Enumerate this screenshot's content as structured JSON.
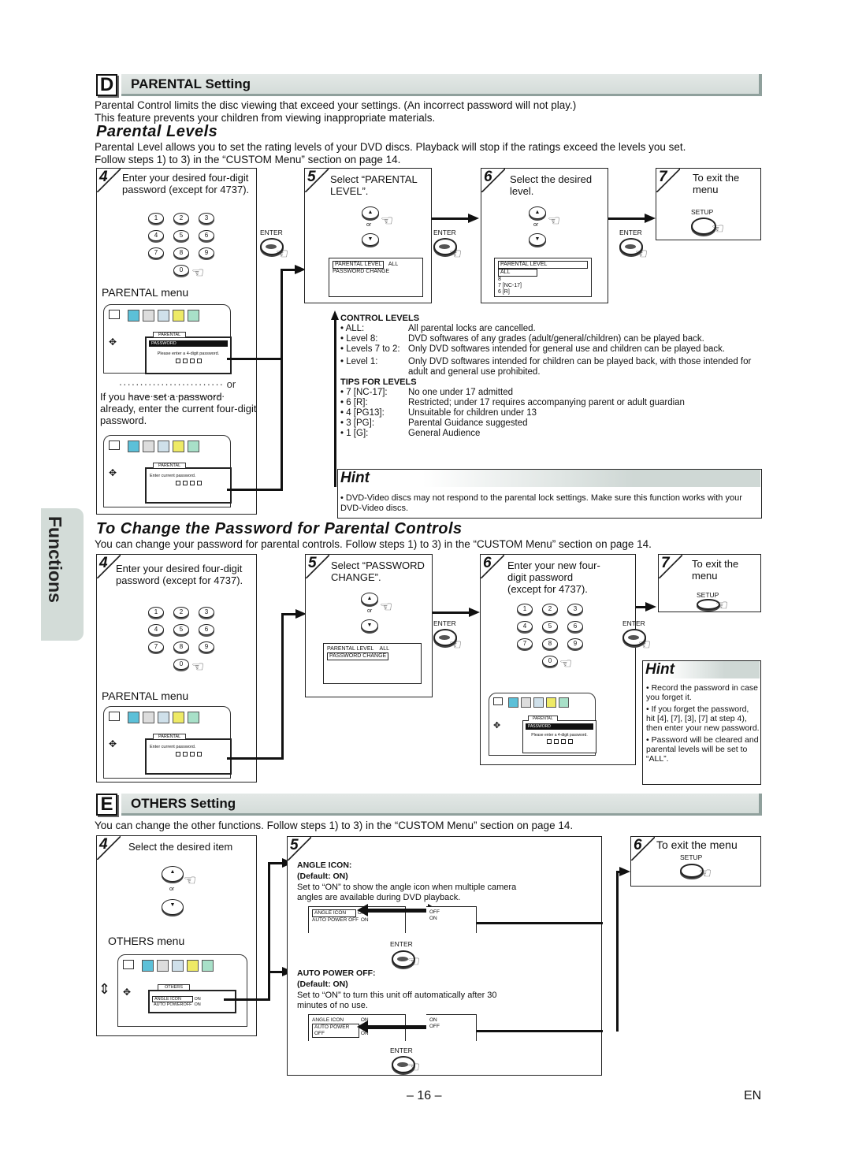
{
  "side_tab": {
    "label": "Functions"
  },
  "section_d": {
    "letter": "D",
    "title": "PARENTAL Setting",
    "intro": [
      "Parental Control limits the disc viewing that exceed your settings. (An incorrect password will not play.)",
      "This feature prevents your children from viewing inappropriate materials."
    ],
    "levels": {
      "heading": "Parental Levels",
      "desc": [
        "Parental Level allows you to set the rating levels of your DVD discs. Playback will stop if the ratings exceed the levels you set.",
        "Follow steps 1) to 3) in the “CUSTOM Menu” section on page 14."
      ],
      "step4": {
        "num": "4",
        "text": "Enter your desired four-digit password (except for 4737).",
        "menu_label": "PARENTAL menu",
        "or_label": "or",
        "alt_text": "If you have set a password already, enter the current four-digit password.",
        "osd_tab": "PARENTAL",
        "osd_title": "PASSWORD",
        "osd_prompt": "Please enter a 4-digit password.",
        "osd_alt_prompt": "Enter current password."
      },
      "step5": {
        "num": "5",
        "text": "Select “PARENTAL LEVEL”.",
        "or_label": "or",
        "osd_line1_item": "PARENTAL LEVEL",
        "osd_line1_value": "ALL",
        "osd_line2": "PASSWORD CHANGE"
      },
      "step6": {
        "num": "6",
        "text": "Select the desired level.",
        "or_label": "or",
        "osd_title": "PARENTAL LEVEL",
        "osd_items": [
          "ALL",
          "8",
          "7 [NC-17]",
          "6 [R]"
        ]
      },
      "step7": {
        "num": "7",
        "text": "To exit the menu",
        "button": "SETUP"
      },
      "enter_label": "ENTER",
      "control_levels": {
        "title": "CONTROL LEVELS",
        "rows": [
          {
            "k": "• ALL:",
            "v": "All parental locks are cancelled."
          },
          {
            "k": "• Level 8:",
            "v": "DVD softwares of any grades (adult/general/children) can be played back."
          },
          {
            "k": "• Levels 7 to 2:",
            "v": "Only DVD softwares intended for general use and children can be played back."
          },
          {
            "k": "• Level 1:",
            "v": "Only DVD softwares intended for children can be played back, with those intended for adult and general use prohibited."
          }
        ]
      },
      "tips": {
        "title": "TIPS FOR LEVELS",
        "rows": [
          {
            "k": "• 7 [NC-17]:",
            "v": "No one under 17 admitted"
          },
          {
            "k": "• 6 [R]:",
            "v": "Restricted; under 17 requires accompanying parent or adult guardian"
          },
          {
            "k": "• 4 [PG13]:",
            "v": "Unsuitable for children under 13"
          },
          {
            "k": "• 3 [PG]:",
            "v": "Parental Guidance suggested"
          },
          {
            "k": "• 1 [G]:",
            "v": "General Audience"
          }
        ]
      },
      "hint": {
        "title": "Hint",
        "text": "• DVD-Video discs may not respond to the parental lock settings. Make sure this function works with your DVD-Video discs."
      }
    },
    "password": {
      "heading": "To Change the Password for Parental Controls",
      "desc": "You can change your password for parental controls. Follow steps 1) to 3) in the “CUSTOM Menu” section on page 14.",
      "step4": {
        "num": "4",
        "text": "Enter your desired four-digit password (except for 4737).",
        "menu_label": "PARENTAL menu",
        "osd_tab": "PARENTAL",
        "osd_prompt": "Enter current password."
      },
      "step5": {
        "num": "5",
        "text": "Select “PASSWORD CHANGE”.",
        "or_label": "or",
        "osd_line1_item": "PARENTAL LEVEL",
        "osd_line1_value": "ALL",
        "osd_line2": "PASSWORD CHANGE"
      },
      "step6": {
        "num": "6",
        "text": "Enter your new four-digit password (except for 4737).",
        "osd_tab": "PARENTAL",
        "osd_title": "PASSWORD",
        "osd_prompt": "Please enter a 4-digit password."
      },
      "step7": {
        "num": "7",
        "text": "To exit the menu",
        "button": "SETUP"
      },
      "enter_label": "ENTER",
      "hint": {
        "title": "Hint",
        "items": [
          "Record the password in case you forget it.",
          "If you forget the password, hit [4], [7], [3], [7] at step 4), then enter your new password.",
          "Password will be cleared and parental levels will be set to “ALL”."
        ]
      }
    }
  },
  "keypad": [
    "1",
    "2",
    "3",
    "4",
    "5",
    "6",
    "7",
    "8",
    "9",
    "0"
  ],
  "section_e": {
    "letter": "E",
    "title": "OTHERS Setting",
    "desc": "You can change the other functions. Follow steps 1) to 3) in the “CUSTOM Menu” section on page 14.",
    "step4": {
      "num": "4",
      "text": "Select the desired item",
      "or_label": "or",
      "menu_label": "OTHERS menu",
      "osd_tab": "OTHERS",
      "osd_rows": [
        {
          "item": "ANGLE ICON",
          "value": "ON"
        },
        {
          "item": "AUTO POWEROFF",
          "value": "ON"
        }
      ]
    },
    "step5": {
      "num": "5",
      "angle": {
        "title": "ANGLE ICON:",
        "default": "(Default: ON)",
        "desc": "Set to “ON” to show the angle icon when multiple camera angles are available during DVD playback.",
        "rows": [
          {
            "item": "ANGLE ICON",
            "value": "ON",
            "alt": "OFF"
          },
          {
            "item": "AUTO POWER OFF",
            "value": "ON",
            "alt": "ON"
          }
        ]
      },
      "auto_power": {
        "title": "AUTO POWER OFF:",
        "default": "(Default: ON)",
        "desc": "Set to “ON” to turn this unit off automatically after 30 minutes of no use.",
        "rows": [
          {
            "item": "ANGLE ICON",
            "value": "ON",
            "alt": "ON"
          },
          {
            "item": "AUTO POWER OFF",
            "value": "ON",
            "alt": "OFF"
          }
        ]
      },
      "enter_label": "ENTER"
    },
    "step6": {
      "num": "6",
      "text": "To exit the menu",
      "button": "SETUP"
    }
  },
  "footer": {
    "page": "– 16 –",
    "lang": "EN"
  }
}
